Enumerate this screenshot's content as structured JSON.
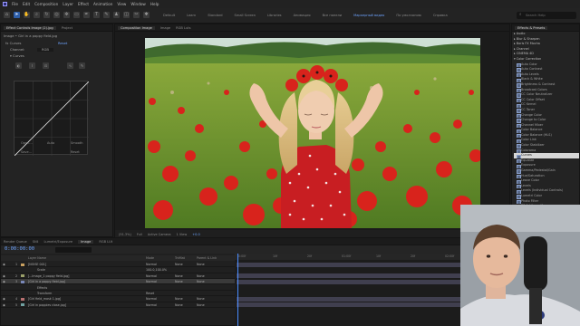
{
  "menu": [
    "File",
    "Edit",
    "Composition",
    "Layer",
    "Effect",
    "Animation",
    "View",
    "Window",
    "Help"
  ],
  "workspaces": [
    "Default",
    "Learn",
    "Standard",
    "Small Screen",
    "Libraries",
    "Анимация",
    "Все панели",
    "Маркерный видео",
    "По умолчанию",
    "Справка"
  ],
  "workspaces_active": "Маркерный видео",
  "search_placeholder": "Search Help",
  "effect_controls": {
    "tab_label": "Effect Controls  Image (2).jpg",
    "project_tab": "Project",
    "layer_path": "Image • Girl in a poppy field.jpg",
    "reset_label": "Reset",
    "rows": [
      {
        "label": "fx  Curves",
        "value": "Reset"
      },
      {
        "label": "Channel:",
        "value": "RGB"
      },
      {
        "label": "▾ Curves",
        "value": ""
      }
    ],
    "buttons": [
      "Open...",
      "Auto",
      "Smooth",
      "Save...",
      "Reset"
    ]
  },
  "composition": {
    "tabs": [
      "Composition  Image",
      "Image",
      "RGB Luts"
    ],
    "active_tab": "Composition  Image",
    "viewer_bar": [
      "(51.3%)",
      "Full",
      "Active Camera",
      "1 View",
      "+0.0"
    ]
  },
  "presets": {
    "tab": "Effects & Presets",
    "items": [
      {
        "label": "▸ Audio",
        "kind": "cat"
      },
      {
        "label": "▸ Blur & Sharpen",
        "kind": "cat"
      },
      {
        "label": "▸ Boris FX Mocha",
        "kind": "cat"
      },
      {
        "label": "▸ Channel",
        "kind": "cat"
      },
      {
        "label": "▸ CINEMA 4D",
        "kind": "cat"
      },
      {
        "label": "▾ Color Correction",
        "kind": "cat"
      },
      {
        "label": "Auto Color",
        "kind": "fx"
      },
      {
        "label": "Auto Contrast",
        "kind": "fx"
      },
      {
        "label": "Auto Levels",
        "kind": "fx"
      },
      {
        "label": "Black & White",
        "kind": "fx"
      },
      {
        "label": "Brightness & Contrast",
        "kind": "fx"
      },
      {
        "label": "Broadcast Colors",
        "kind": "fx"
      },
      {
        "label": "CC Color Neutralizer",
        "kind": "fx"
      },
      {
        "label": "CC Color Offset",
        "kind": "fx"
      },
      {
        "label": "CC Kernel",
        "kind": "fx"
      },
      {
        "label": "CC Toner",
        "kind": "fx"
      },
      {
        "label": "Change Color",
        "kind": "fx"
      },
      {
        "label": "Change to Color",
        "kind": "fx"
      },
      {
        "label": "Channel Mixer",
        "kind": "fx"
      },
      {
        "label": "Color Balance",
        "kind": "fx"
      },
      {
        "label": "Color Balance (HLS)",
        "kind": "fx"
      },
      {
        "label": "Color Link",
        "kind": "fx"
      },
      {
        "label": "Color Stabilizer",
        "kind": "fx"
      },
      {
        "label": "Colorama",
        "kind": "fx"
      },
      {
        "label": "Curves",
        "kind": "fx sel"
      },
      {
        "label": "Equalize",
        "kind": "fx"
      },
      {
        "label": "Exposure",
        "kind": "fx"
      },
      {
        "label": "Gamma/Pedestal/Gain",
        "kind": "fx"
      },
      {
        "label": "Hue/Saturation",
        "kind": "fx"
      },
      {
        "label": "Leave Color",
        "kind": "fx"
      },
      {
        "label": "Levels",
        "kind": "fx"
      },
      {
        "label": "Levels (Individual Controls)",
        "kind": "fx"
      },
      {
        "label": "Lumetri Color",
        "kind": "fx"
      },
      {
        "label": "Photo Filter",
        "kind": "fx"
      },
      {
        "label": "PS Arbitrary Map",
        "kind": "fx"
      },
      {
        "label": "Selective Color",
        "kind": "fx"
      },
      {
        "label": "Shadow/Highlight",
        "kind": "fx"
      },
      {
        "label": "Tint",
        "kind": "fx"
      },
      {
        "label": "Tritone",
        "kind": "fx"
      },
      {
        "label": "Vibrance",
        "kind": "fx"
      }
    ]
  },
  "timeline": {
    "tabs": [
      "Render Queue",
      "Still",
      "Lumetri/Exposure",
      "Image",
      "RGB LUt"
    ],
    "active_tab": "Image",
    "timecode": "0:00:00:00",
    "columns": [
      "Layer Name",
      "Mode",
      "TrkMat",
      "Parent & Link"
    ],
    "ruler": [
      "0:00f",
      "10f",
      "20f",
      "01:00f",
      "10f",
      "20f",
      "02:00f",
      "10f",
      "20f",
      "03:00f"
    ],
    "layers": [
      {
        "num": "1",
        "name": "[NOISE 001]",
        "mode": "Normal",
        "trk": "None",
        "parent": "None",
        "color": "#c8a060",
        "sel": false
      },
      {
        "num": "",
        "name": "Scale",
        "mode": "100.0,100.0%",
        "trk": "",
        "parent": "",
        "color": "",
        "sel": false
      },
      {
        "num": "2",
        "name": "[...Image_1 poppy field.jpg]",
        "mode": "Normal",
        "trk": "None",
        "parent": "None",
        "color": "#9aa06a",
        "sel": false
      },
      {
        "num": "3",
        "name": "[Girl in a poppy field.jpg]",
        "mode": "Normal",
        "trk": "None",
        "parent": "None",
        "color": "#7a88b8",
        "sel": true
      },
      {
        "num": "",
        "name": "Effects",
        "mode": "",
        "trk": "",
        "parent": "",
        "color": "",
        "sel": false
      },
      {
        "num": "",
        "name": "Transform",
        "mode": "Reset",
        "trk": "",
        "parent": "",
        "color": "",
        "sel": false
      },
      {
        "num": "4",
        "name": "[Girl field_mask 1.jpg]",
        "mode": "Normal",
        "trk": "None",
        "parent": "None",
        "color": "#b87070",
        "sel": false
      },
      {
        "num": "5",
        "name": "[Girl in poppies close.jpg]",
        "mode": "Normal",
        "trk": "None",
        "parent": "None",
        "color": "#70a0a0",
        "sel": false
      }
    ]
  },
  "colors": {
    "accent": "#4a8cff",
    "poppy": "#d8231c",
    "dress": "#c81e22",
    "field": "#6e9a2a"
  }
}
